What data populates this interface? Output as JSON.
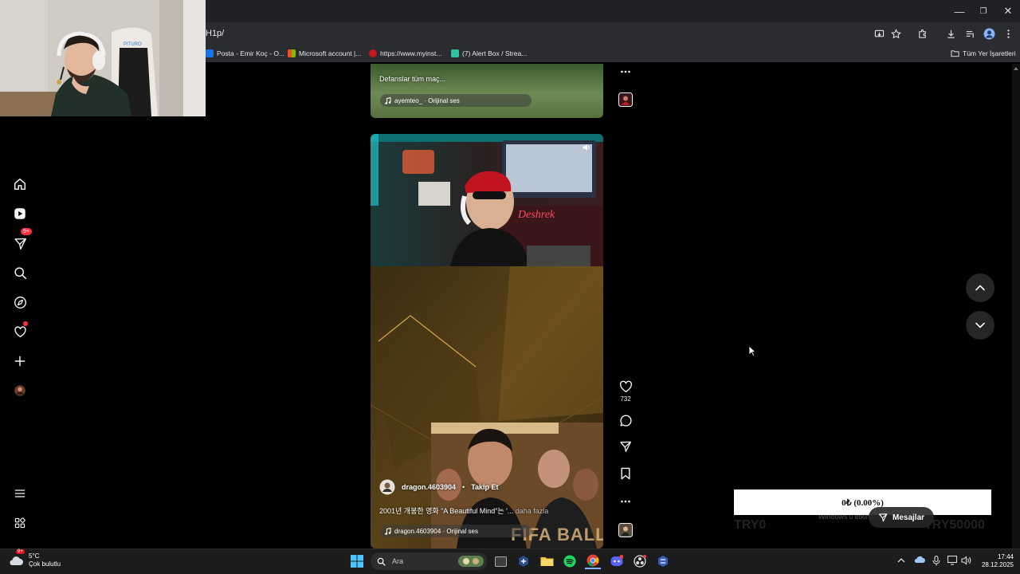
{
  "browser": {
    "url": "H1p/",
    "bookmarks": [
      {
        "label": "Posta - Emir Koç - O...",
        "color": "#1a73e8"
      },
      {
        "label": "Microsoft account |...",
        "color": "#f25022"
      },
      {
        "label": "https://www.myinst...",
        "color": "#c4161c"
      },
      {
        "label": "(7) Alert Box / Strea...",
        "color": "#31c3a2"
      }
    ],
    "all_bookmarks_label": "Tüm Yer İşaretleri",
    "window_controls": [
      "—",
      "❐",
      "✕"
    ]
  },
  "sidebar": {
    "items": [
      {
        "name": "home-icon"
      },
      {
        "name": "reels-icon"
      },
      {
        "name": "messages-icon",
        "badge": "9+"
      },
      {
        "name": "search-icon"
      },
      {
        "name": "explore-icon"
      },
      {
        "name": "notifications-icon"
      },
      {
        "name": "create-icon"
      },
      {
        "name": "profile-icon"
      }
    ]
  },
  "reel1": {
    "caption": "Defanslar tüm maç...",
    "audio": "ayemteo_ · Orijinal ses"
  },
  "reel2": {
    "username": "dragon.4603904",
    "separator": "•",
    "follow": "Takip Et",
    "caption": "2001년 개봉한 영화 “A Beautiful Mind”는 '...",
    "more": "daha fazla",
    "audio": "dragon.4603904 · Orijinal ses",
    "overlay_text": "FIFA BALLO",
    "likes": "732"
  },
  "overlay": {
    "donation": "0₺ (0.00%)",
    "tr_left": "TRY0",
    "tr_right": "TRY50000",
    "windows_watermark": "Windows'u etkinleştir",
    "messages": "Mesajlar"
  },
  "taskbar": {
    "weather_temp": "5°C",
    "weather_desc": "Çok bulutlu",
    "weather_badge": "9+",
    "search_placeholder": "Ara",
    "time": "17:44",
    "date": "28.12.2025"
  }
}
